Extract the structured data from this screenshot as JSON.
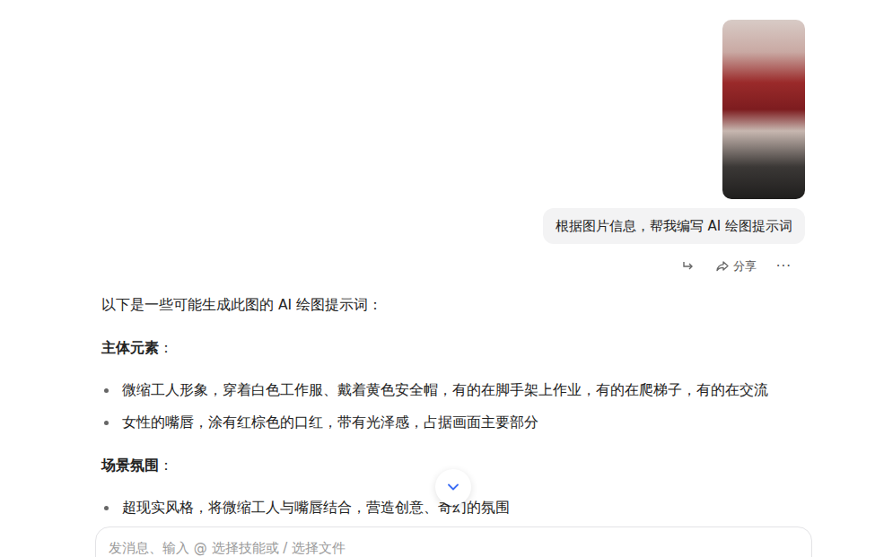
{
  "user_message": {
    "attachment": {
      "kind": "photo"
    },
    "text": "根据图片信息，帮我编写 AI 绘图提示词"
  },
  "message_actions": {
    "share_label": "分享",
    "more": "···"
  },
  "reply": {
    "intro": "以下是一些可能生成此图的 AI 绘图提示词：",
    "sections": [
      {
        "heading": "主体元素",
        "colon": "：",
        "bullets": [
          "微缩工人形象，穿着白色工作服、戴着黄色安全帽，有的在脚手架上作业，有的在爬梯子，有的在交流",
          "女性的嘴唇，涂有红棕色的口红，带有光泽感，占据画面主要部分"
        ]
      },
      {
        "heading": "场景氛围",
        "colon": "：",
        "bullets": [
          "超现实风格，将微缩工人与嘴唇结合，营造创意、奇幻的氛围"
        ]
      }
    ]
  },
  "input": {
    "placeholder": "发消息、输入 @ 选择技能或 / 选择文件"
  }
}
